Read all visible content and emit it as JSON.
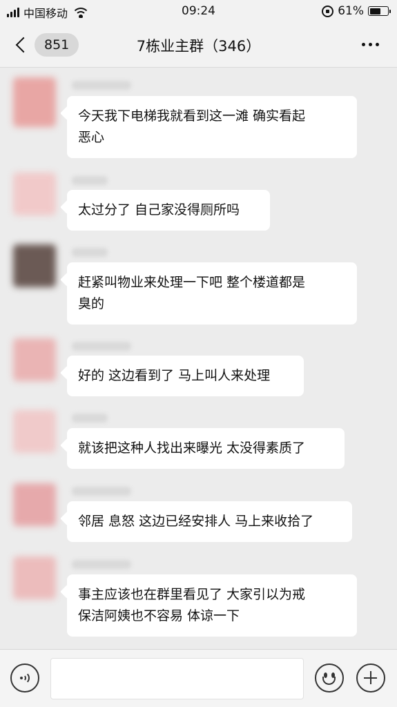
{
  "status_bar": {
    "carrier": "中国移动",
    "time": "09:24",
    "battery_text": "61%",
    "battery_level": 0.61
  },
  "nav": {
    "unread_count": "851",
    "title": "7栋业主群（346）"
  },
  "messages": [
    {
      "text": "今天我下电梯我就看到这一滩 确实看起\n恶心",
      "avatar_color": "#e8a6a4"
    },
    {
      "text": "太过分了 自己家没得厕所吗",
      "avatar_color": "#f1c9c9"
    },
    {
      "text": "赶紧叫物业来处理一下吧 整个楼道都是\n臭的",
      "avatar_color": "#6b5a55"
    },
    {
      "text": "好的 这边看到了 马上叫人来处理",
      "avatar_color": "#eab4b4"
    },
    {
      "text": "就该把这种人找出来曝光 太没得素质了",
      "avatar_color": "#f0caca"
    },
    {
      "text": "邻居 息怒 这边已经安排人 马上来收拾了",
      "avatar_color": "#e6a9ab"
    },
    {
      "text": "事主应该也在群里看见了 大家引以为戒\n保洁阿姨也不容易 体谅一下",
      "avatar_color": "#ecbcbc"
    }
  ],
  "input_bar": {
    "placeholder": ""
  }
}
